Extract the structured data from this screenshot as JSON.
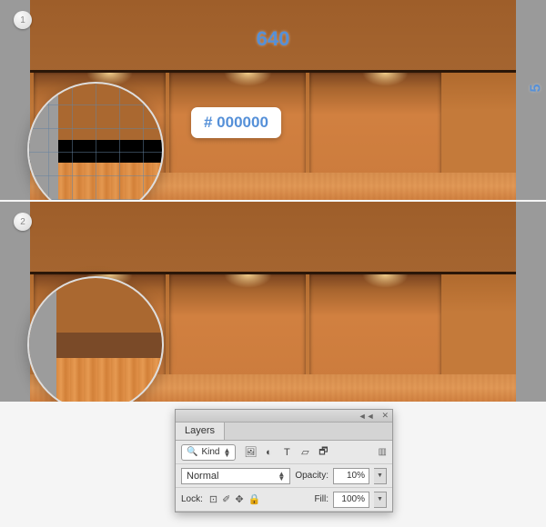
{
  "steps": {
    "one": "1",
    "two": "2"
  },
  "dimensions": {
    "width": "640",
    "height": "5"
  },
  "hex_value": "# 000000",
  "layers_panel": {
    "title": "Layers",
    "collapse_icon": "◄◄",
    "close_icon": "✕",
    "filter": {
      "label": "Kind",
      "search_glyph": "🔍"
    },
    "type_icons": {
      "image": "🖼",
      "adjustment": "◐",
      "text": "T",
      "shape": "▱",
      "smart": "🗗"
    },
    "blend_mode": "Normal",
    "opacity": {
      "label": "Opacity:",
      "value": "10%"
    },
    "lock": {
      "label": "Lock:",
      "transparency": "⊡",
      "brush": "✐",
      "position": "✥",
      "all": "🔒"
    },
    "fill": {
      "label": "Fill:",
      "value": "100%"
    }
  }
}
